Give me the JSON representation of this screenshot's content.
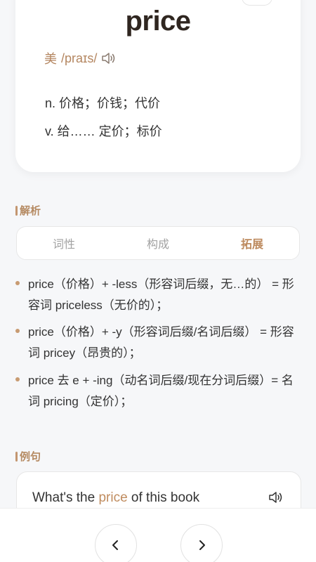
{
  "word": {
    "headword": "price",
    "phonetic_region": "美",
    "phonetic": "/praɪs/",
    "definitions": [
      "n. 价格；价钱；代价",
      "v. 给…… 定价；标价"
    ]
  },
  "analysis": {
    "title": "解析",
    "tabs": [
      {
        "label": "词性",
        "active": false
      },
      {
        "label": "构成",
        "active": false
      },
      {
        "label": "拓展",
        "active": true
      }
    ],
    "items": [
      "price（价格）+ -less（形容词后缀，无…的） = 形容词 priceless（无价的）；",
      "price（价格）+ -y（形容词后缀/名词后缀） = 形容词 pricey（昂贵的）；",
      "price 去 e + -ing（动名词后缀/现在分词后缀）= 名词 pricing（定价）；"
    ]
  },
  "examples": {
    "title": "例句",
    "sentence_before": "What's the ",
    "sentence_highlight": "price",
    "sentence_after": " of this book"
  },
  "icons": {
    "speaker": "speaker-icon",
    "prev": "chevron-left-icon",
    "next": "chevron-right-icon"
  },
  "colors": {
    "accent": "#bd8a5e",
    "headword": "#2f2620",
    "background": "#f6f7f9"
  }
}
